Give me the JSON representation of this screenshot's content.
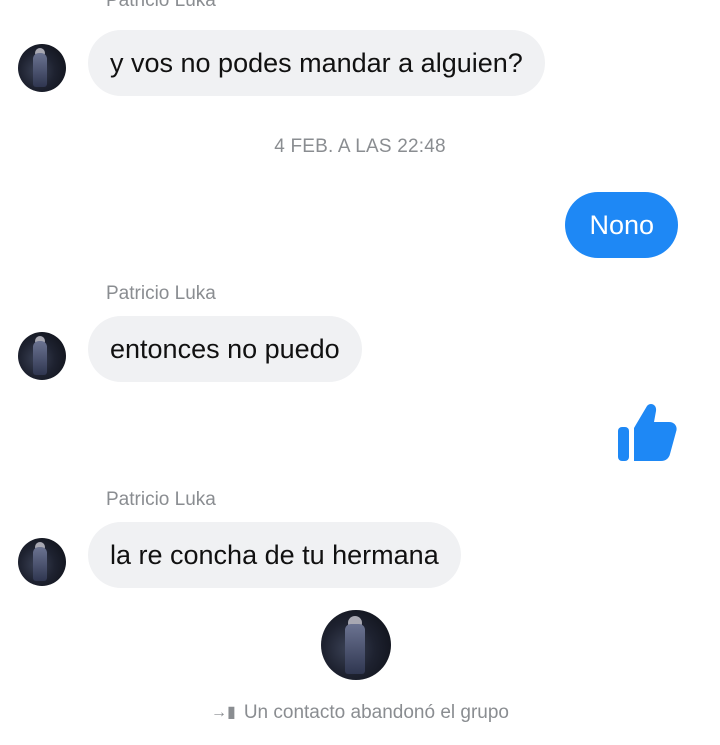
{
  "messages": {
    "first_sender": "Patricio Luka",
    "msg1": "y vos no podes mandar a alguien?",
    "timestamp": "4 FEB. A LAS 22:48",
    "out1": "Nono",
    "sender2": "Patricio Luka",
    "msg2": "entonces no puedo",
    "sender3": "Patricio Luka",
    "msg3": "la re concha de tu hermana"
  },
  "system": {
    "icon": "exit-icon",
    "text": "Un contacto abandonó el grupo"
  },
  "colors": {
    "outgoing_bubble": "#1e88f5",
    "incoming_bubble": "#f0f1f3",
    "like": "#1e88f5"
  }
}
